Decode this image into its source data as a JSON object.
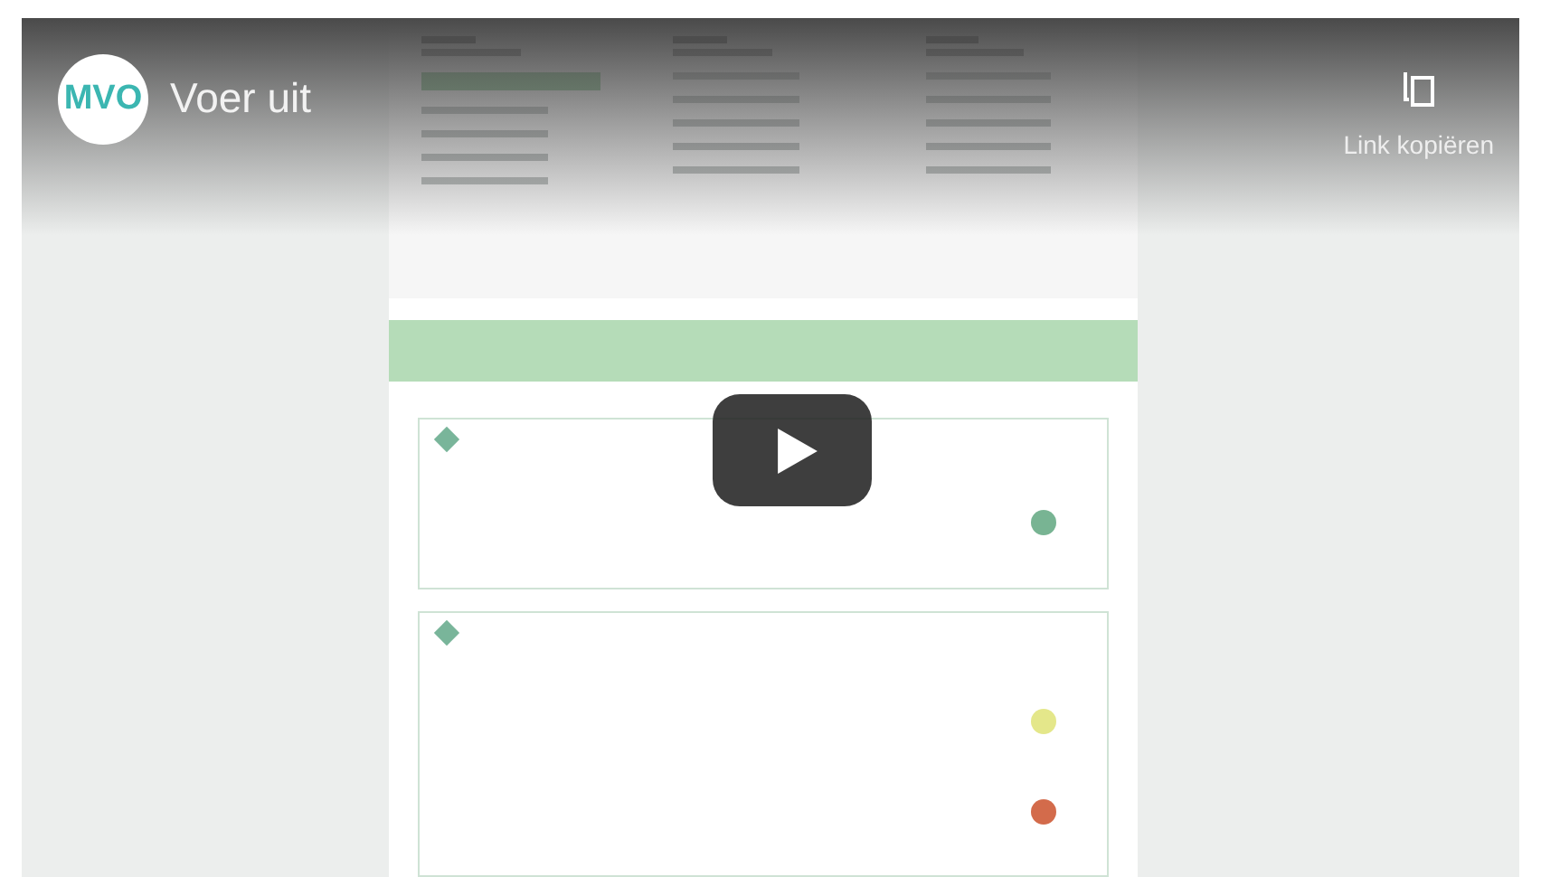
{
  "video": {
    "channel_logo": "MVO",
    "title": "Voer uit",
    "share": {
      "label": "Link kopiëren"
    }
  }
}
